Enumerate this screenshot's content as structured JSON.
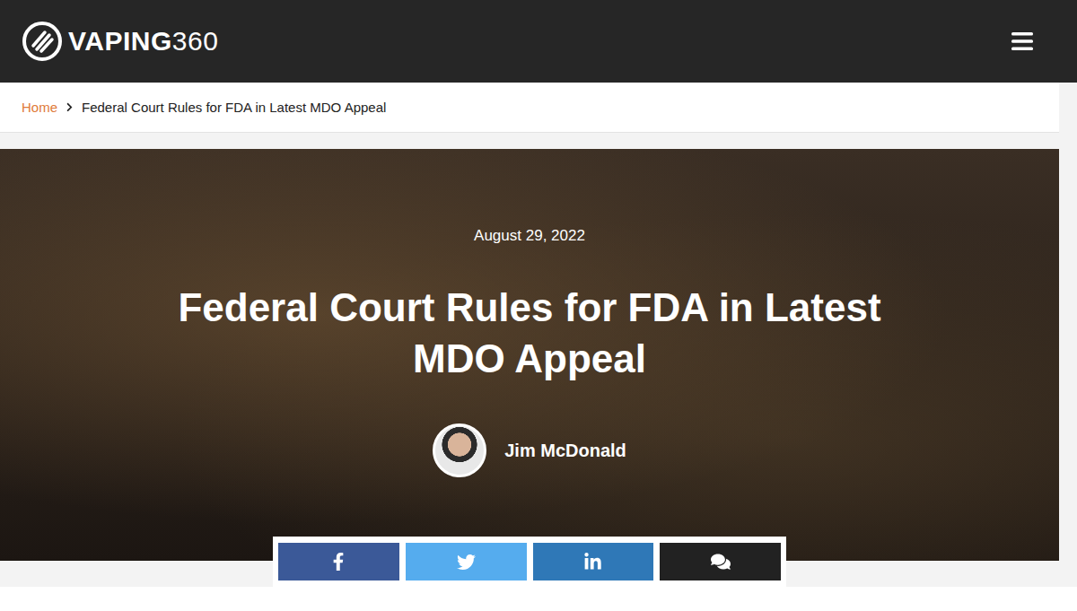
{
  "header": {
    "logo": {
      "bold": "VAPING",
      "light": "360"
    }
  },
  "breadcrumb": [
    {
      "label": "Home",
      "link": true
    },
    {
      "label": "Federal Court Rules for FDA in Latest MDO Appeal",
      "link": false
    }
  ],
  "hero": {
    "date": "August 29, 2022",
    "title": "Federal Court Rules for FDA in Latest MDO Appeal",
    "author": "Jim McDonald"
  },
  "share_buttons": [
    {
      "kind": "facebook",
      "color": "#3b5998"
    },
    {
      "kind": "twitter",
      "color": "#55acee"
    },
    {
      "kind": "linkedin",
      "color": "#2f78b7"
    },
    {
      "kind": "comments",
      "color": "#222222"
    }
  ]
}
